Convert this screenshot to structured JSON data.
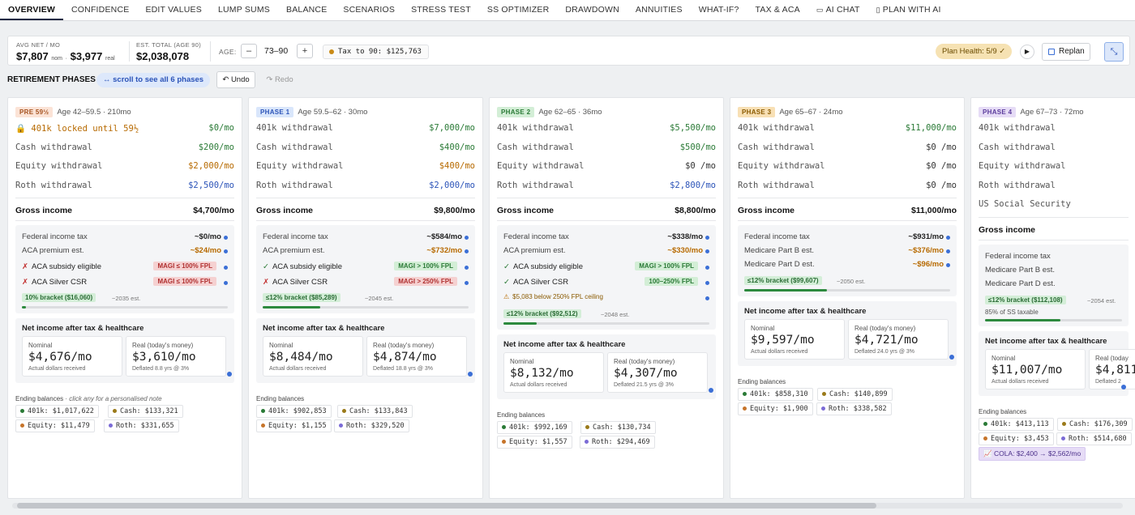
{
  "tabs": [
    "OVERVIEW",
    "CONFIDENCE",
    "EDIT VALUES",
    "LUMP SUMS",
    "BALANCE",
    "SCENARIOS",
    "STRESS TEST",
    "SS OPTIMIZER",
    "DRAWDOWN",
    "ANNUITIES",
    "WHAT-IF?",
    "TAX & ACA",
    "AI CHAT",
    "PLAN WITH AI"
  ],
  "stats": {
    "avg_label": "AVG NET / MO",
    "avg_nom": "$7,807",
    "nom": "nom",
    "sep": "·",
    "avg_real": "$3,977",
    "real": "real",
    "est_label": "EST. TOTAL (AGE 90)",
    "est_value": "$2,038,078",
    "age_label": "AGE:",
    "minus": "–",
    "age_range": "73–90",
    "plus": "+",
    "tax_text": "Tax to 90: $125,763",
    "health": "Plan Health: 5/9 ✓",
    "replan": "Replan"
  },
  "phases_header": {
    "title": "RETIREMENT PHASES",
    "scroll_hint": "↔ scroll to see all 6 phases",
    "undo": "↶ Undo",
    "redo": "↷ Redo"
  },
  "cards": [
    {
      "badge": "PRE 59½",
      "age": "Age 42–59.5 · 210mo",
      "rows": [
        {
          "label": "🔒 401k locked until 59½",
          "value": "$0/mo",
          "locked": true
        },
        {
          "label": "Cash withdrawal",
          "value": "$200/mo"
        },
        {
          "label": "Equity withdrawal",
          "value": "$2,000/mo"
        },
        {
          "label": "Roth withdrawal",
          "value": "$2,500/mo"
        }
      ],
      "gross": "Gross income",
      "gross_value": "$4,700/mo",
      "tax": [
        {
          "label": "Federal income tax",
          "value": "~$0/mo"
        },
        {
          "label": "ACA premium est.",
          "value": "~$24/mo"
        }
      ],
      "elig": [
        {
          "icon": "✗",
          "label": "ACA subsidy eligible",
          "tag": "MAGI ≤ 100% FPL",
          "tone": "red"
        },
        {
          "icon": "✗",
          "label": "ACA Silver CSR",
          "tag": "MAGI ≤ 100% FPL",
          "tone": "red"
        }
      ],
      "bracket": "10% bracket ($16,060)",
      "bracket_note": "~2035 est.",
      "bracket_fill": 0.02,
      "net_title": "Net income after tax & healthcare",
      "nominal_label": "Nominal",
      "nominal": "$4,676/mo",
      "nominal_note": "Actual dollars received",
      "real_label": "Real (today's money)",
      "real": "$3,610/mo",
      "real_note": "Deflated 8.8 yrs @ 3%",
      "ending_label": "Ending balances",
      "ending_note": " · click any for a personalised note",
      "balances": {
        "k401": "401k: $1,017,622",
        "cash": "Cash: $133,321",
        "equity": "Equity: $11,479",
        "roth": "Roth: $331,655"
      }
    },
    {
      "badge": "PHASE 1",
      "age": "Age 59.5–62 · 30mo",
      "rows": [
        {
          "label": "401k withdrawal",
          "value": "$7,000/mo"
        },
        {
          "label": "Cash withdrawal",
          "value": "$400/mo"
        },
        {
          "label": "Equity withdrawal",
          "value": "$400/mo"
        },
        {
          "label": "Roth withdrawal",
          "value": "$2,000/mo"
        }
      ],
      "gross": "Gross income",
      "gross_value": "$9,800/mo",
      "tax": [
        {
          "label": "Federal income tax",
          "value": "~$584/mo"
        },
        {
          "label": "ACA premium est.",
          "value": "~$732/mo"
        }
      ],
      "elig": [
        {
          "icon": "✓",
          "label": "ACA subsidy eligible",
          "tag": "MAGI > 100% FPL",
          "tone": "grn"
        },
        {
          "icon": "✗",
          "label": "ACA Silver CSR",
          "tag": "MAGI > 250% FPL",
          "tone": "red"
        }
      ],
      "bracket": "≤12% bracket ($85,289)",
      "bracket_note": "~2045 est.",
      "bracket_fill": 0.28,
      "net_title": "Net income after tax & healthcare",
      "nominal_label": "Nominal",
      "nominal": "$8,484/mo",
      "nominal_note": "Actual dollars received",
      "real_label": "Real (today's money)",
      "real": "$4,874/mo",
      "real_note": "Deflated 18.8 yrs @ 3%",
      "ending_label": "Ending balances",
      "ending_note": "",
      "balances": {
        "k401": "401k: $902,853",
        "cash": "Cash: $133,843",
        "equity": "Equity: $1,155",
        "roth": "Roth: $329,520"
      }
    },
    {
      "badge": "PHASE 2",
      "age": "Age 62–65 · 36mo",
      "rows": [
        {
          "label": "401k withdrawal",
          "value": "$5,500/mo"
        },
        {
          "label": "Cash withdrawal",
          "value": "$500/mo"
        },
        {
          "label": "Equity withdrawal",
          "value": "$0 /mo"
        },
        {
          "label": "Roth withdrawal",
          "value": "$2,800/mo"
        }
      ],
      "gross": "Gross income",
      "gross_value": "$8,800/mo",
      "tax": [
        {
          "label": "Federal income tax",
          "value": "~$338/mo"
        },
        {
          "label": "ACA premium est.",
          "value": "~$330/mo"
        }
      ],
      "elig": [
        {
          "icon": "✓",
          "label": "ACA subsidy eligible",
          "tag": "MAGI > 100% FPL",
          "tone": "grn"
        },
        {
          "icon": "✓",
          "label": "ACA Silver CSR",
          "tag": "100–250% FPL",
          "tone": "grn"
        }
      ],
      "warn": "$5,083 below 250% FPL ceiling",
      "bracket": "≤12% bracket ($92,512)",
      "bracket_note": "~2048 est.",
      "bracket_fill": 0.16,
      "net_title": "Net income after tax & healthcare",
      "nominal_label": "Nominal",
      "nominal": "$8,132/mo",
      "nominal_note": "Actual dollars received",
      "real_label": "Real (today's money)",
      "real": "$4,307/mo",
      "real_note": "Deflated 21.5 yrs @ 3%",
      "ending_label": "Ending balances",
      "ending_note": "",
      "balances": {
        "k401": "401k: $992,169",
        "cash": "Cash: $130,734",
        "equity": "Equity: $1,557",
        "roth": "Roth: $294,469"
      }
    },
    {
      "badge": "PHASE 3",
      "age": "Age 65–67 · 24mo",
      "rows": [
        {
          "label": "401k withdrawal",
          "value": "$11,000/mo"
        },
        {
          "label": "Cash withdrawal",
          "value": "$0 /mo"
        },
        {
          "label": "Equity withdrawal",
          "value": "$0 /mo"
        },
        {
          "label": "Roth withdrawal",
          "value": "$0 /mo"
        }
      ],
      "gross": "Gross income",
      "gross_value": "$11,000/mo",
      "tax": [
        {
          "label": "Federal income tax",
          "value": "~$931/mo"
        },
        {
          "label": "Medicare Part B est.",
          "value": "~$376/mo"
        },
        {
          "label": "Medicare Part D est.",
          "value": "~$96/mo"
        }
      ],
      "elig": [],
      "bracket": "≤12% bracket ($99,607)",
      "bracket_note": "~2050 est.",
      "bracket_fill": 0.4,
      "net_title": "Net income after tax & healthcare",
      "nominal_label": "Nominal",
      "nominal": "$9,597/mo",
      "nominal_note": "Actual dollars received",
      "real_label": "Real (today's money)",
      "real": "$4,721/mo",
      "real_note": "Deflated 24.0 yrs @ 3%",
      "ending_label": "Ending balances",
      "ending_note": "",
      "balances": {
        "k401": "401k: $858,310",
        "cash": "Cash: $140,899",
        "equity": "Equity: $1,900",
        "roth": "Roth: $338,582"
      }
    },
    {
      "badge": "PHASE 4",
      "age": "Age 67–73 · 72mo",
      "rows": [
        {
          "label": "401k withdrawal",
          "value": ""
        },
        {
          "label": "Cash withdrawal",
          "value": ""
        },
        {
          "label": "Equity withdrawal",
          "value": ""
        },
        {
          "label": "Roth withdrawal",
          "value": ""
        },
        {
          "label": "US Social Security",
          "value": ""
        }
      ],
      "gross": "Gross income",
      "gross_value": "",
      "tax": [
        {
          "label": "Federal income tax",
          "value": ""
        },
        {
          "label": "Medicare Part B est.",
          "value": ""
        },
        {
          "label": "Medicare Part D est.",
          "value": ""
        }
      ],
      "elig": [],
      "bracket": "≤12% bracket ($112,108)",
      "bracket_note": "~2054 est.",
      "ss_note": "85% of SS taxable",
      "bracket_fill": 0.55,
      "net_title": "Net income after tax & healthcare",
      "nominal_label": "Nominal",
      "nominal": "$11,007/mo",
      "nominal_note": "Actual dollars received",
      "real_label": "Real (today",
      "real": "$4,811",
      "real_note": "Deflated 2",
      "ending_label": "Ending balances",
      "ending_note": "",
      "balances": {
        "k401": "401k: $413,113",
        "cash": "Cash: $176,309",
        "equity": "Equity: $3,453",
        "roth": "Roth: $514,680"
      },
      "cola": "📈 COLA: $2,400 → $2,562/mo"
    }
  ],
  "colors": {
    "green": "#2a7a36",
    "orange": "#b76a00",
    "blue": "#2b53b8",
    "accent": "#3b6fd6"
  }
}
